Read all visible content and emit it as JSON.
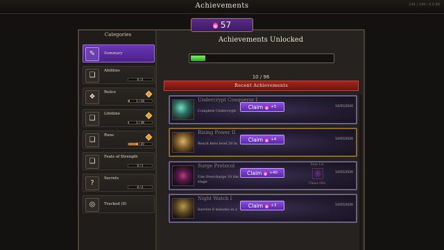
{
  "window": {
    "title": "Achievements",
    "version": "144 | 149 | 0.0.89"
  },
  "points": {
    "value": "57",
    "icon": "soul-flame-icon"
  },
  "categories": {
    "header": "Categories",
    "items": [
      {
        "label": "Summary",
        "icon": "scroll-icon",
        "selected": true
      },
      {
        "label": "Abilities",
        "icon": "book-icon",
        "progress_text": "0 / 2",
        "progress": 0,
        "alert": false
      },
      {
        "label": "Relics",
        "icon": "relic-icon",
        "progress_text": "1 / 18",
        "progress": 0.06,
        "alert": true
      },
      {
        "label": "Lifetime",
        "icon": "book-icon",
        "progress_text": "1 / 38",
        "progress": 0.03,
        "alert": true
      },
      {
        "label": "Runs",
        "icon": "book-icon",
        "progress_text": "8 / 20",
        "progress": 0.4,
        "alert": true
      },
      {
        "label": "Feats of Strength",
        "icon": "book-icon",
        "progress_text": "0 / 1",
        "progress": 0,
        "alert": false
      },
      {
        "label": "Secrets",
        "icon": "question-icon",
        "progress_text": "0 / 2",
        "progress": 0,
        "alert": false
      },
      {
        "label": "Tracked (0)",
        "icon": "target-icon"
      }
    ]
  },
  "summary": {
    "title": "Achievements Unlocked",
    "progress_text": "10 / 96",
    "progress": 0.104
  },
  "recent": {
    "header": "Recent Achievements",
    "items": [
      {
        "name": "Undercrypt Conqueror I",
        "desc": "Complete Undercrypt",
        "claim_label": "Claim",
        "reward": "+5",
        "date": "14/05/2026"
      },
      {
        "name": "Rising Power II",
        "desc": "Reach hero level 20 in",
        "claim_label": "Claim",
        "reward": "+4",
        "date": "14/05/2026"
      },
      {
        "name": "Surge Protocol",
        "desc": "Use Overcharge 10 tim",
        "desc2": "stage",
        "claim_label": "Claim",
        "reward": "+40",
        "date": "14/05/2026",
        "extra_top": "Item Lvl",
        "extra_bottom": "Chaos Orb"
      },
      {
        "name": "Night Watch I",
        "desc": "Survive 8 minutes in a",
        "claim_label": "Claim",
        "reward": "+3",
        "date": "14/05/2026"
      }
    ]
  }
}
